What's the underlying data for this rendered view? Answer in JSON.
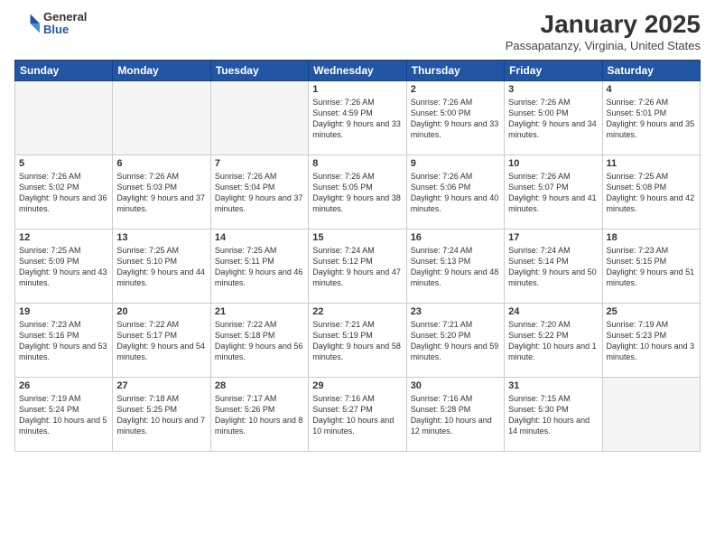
{
  "header": {
    "logo": {
      "general": "General",
      "blue": "Blue"
    },
    "title": "January 2025",
    "subtitle": "Passapatanzy, Virginia, United States"
  },
  "days_of_week": [
    "Sunday",
    "Monday",
    "Tuesday",
    "Wednesday",
    "Thursday",
    "Friday",
    "Saturday"
  ],
  "weeks": [
    [
      {
        "day": "",
        "info": ""
      },
      {
        "day": "",
        "info": ""
      },
      {
        "day": "",
        "info": ""
      },
      {
        "day": "1",
        "info": "Sunrise: 7:26 AM\nSunset: 4:59 PM\nDaylight: 9 hours and 33 minutes."
      },
      {
        "day": "2",
        "info": "Sunrise: 7:26 AM\nSunset: 5:00 PM\nDaylight: 9 hours and 33 minutes."
      },
      {
        "day": "3",
        "info": "Sunrise: 7:26 AM\nSunset: 5:00 PM\nDaylight: 9 hours and 34 minutes."
      },
      {
        "day": "4",
        "info": "Sunrise: 7:26 AM\nSunset: 5:01 PM\nDaylight: 9 hours and 35 minutes."
      }
    ],
    [
      {
        "day": "5",
        "info": "Sunrise: 7:26 AM\nSunset: 5:02 PM\nDaylight: 9 hours and 36 minutes."
      },
      {
        "day": "6",
        "info": "Sunrise: 7:26 AM\nSunset: 5:03 PM\nDaylight: 9 hours and 37 minutes."
      },
      {
        "day": "7",
        "info": "Sunrise: 7:26 AM\nSunset: 5:04 PM\nDaylight: 9 hours and 37 minutes."
      },
      {
        "day": "8",
        "info": "Sunrise: 7:26 AM\nSunset: 5:05 PM\nDaylight: 9 hours and 38 minutes."
      },
      {
        "day": "9",
        "info": "Sunrise: 7:26 AM\nSunset: 5:06 PM\nDaylight: 9 hours and 40 minutes."
      },
      {
        "day": "10",
        "info": "Sunrise: 7:26 AM\nSunset: 5:07 PM\nDaylight: 9 hours and 41 minutes."
      },
      {
        "day": "11",
        "info": "Sunrise: 7:25 AM\nSunset: 5:08 PM\nDaylight: 9 hours and 42 minutes."
      }
    ],
    [
      {
        "day": "12",
        "info": "Sunrise: 7:25 AM\nSunset: 5:09 PM\nDaylight: 9 hours and 43 minutes."
      },
      {
        "day": "13",
        "info": "Sunrise: 7:25 AM\nSunset: 5:10 PM\nDaylight: 9 hours and 44 minutes."
      },
      {
        "day": "14",
        "info": "Sunrise: 7:25 AM\nSunset: 5:11 PM\nDaylight: 9 hours and 46 minutes."
      },
      {
        "day": "15",
        "info": "Sunrise: 7:24 AM\nSunset: 5:12 PM\nDaylight: 9 hours and 47 minutes."
      },
      {
        "day": "16",
        "info": "Sunrise: 7:24 AM\nSunset: 5:13 PM\nDaylight: 9 hours and 48 minutes."
      },
      {
        "day": "17",
        "info": "Sunrise: 7:24 AM\nSunset: 5:14 PM\nDaylight: 9 hours and 50 minutes."
      },
      {
        "day": "18",
        "info": "Sunrise: 7:23 AM\nSunset: 5:15 PM\nDaylight: 9 hours and 51 minutes."
      }
    ],
    [
      {
        "day": "19",
        "info": "Sunrise: 7:23 AM\nSunset: 5:16 PM\nDaylight: 9 hours and 53 minutes."
      },
      {
        "day": "20",
        "info": "Sunrise: 7:22 AM\nSunset: 5:17 PM\nDaylight: 9 hours and 54 minutes."
      },
      {
        "day": "21",
        "info": "Sunrise: 7:22 AM\nSunset: 5:18 PM\nDaylight: 9 hours and 56 minutes."
      },
      {
        "day": "22",
        "info": "Sunrise: 7:21 AM\nSunset: 5:19 PM\nDaylight: 9 hours and 58 minutes."
      },
      {
        "day": "23",
        "info": "Sunrise: 7:21 AM\nSunset: 5:20 PM\nDaylight: 9 hours and 59 minutes."
      },
      {
        "day": "24",
        "info": "Sunrise: 7:20 AM\nSunset: 5:22 PM\nDaylight: 10 hours and 1 minute."
      },
      {
        "day": "25",
        "info": "Sunrise: 7:19 AM\nSunset: 5:23 PM\nDaylight: 10 hours and 3 minutes."
      }
    ],
    [
      {
        "day": "26",
        "info": "Sunrise: 7:19 AM\nSunset: 5:24 PM\nDaylight: 10 hours and 5 minutes."
      },
      {
        "day": "27",
        "info": "Sunrise: 7:18 AM\nSunset: 5:25 PM\nDaylight: 10 hours and 7 minutes."
      },
      {
        "day": "28",
        "info": "Sunrise: 7:17 AM\nSunset: 5:26 PM\nDaylight: 10 hours and 8 minutes."
      },
      {
        "day": "29",
        "info": "Sunrise: 7:16 AM\nSunset: 5:27 PM\nDaylight: 10 hours and 10 minutes."
      },
      {
        "day": "30",
        "info": "Sunrise: 7:16 AM\nSunset: 5:28 PM\nDaylight: 10 hours and 12 minutes."
      },
      {
        "day": "31",
        "info": "Sunrise: 7:15 AM\nSunset: 5:30 PM\nDaylight: 10 hours and 14 minutes."
      },
      {
        "day": "",
        "info": ""
      }
    ]
  ]
}
